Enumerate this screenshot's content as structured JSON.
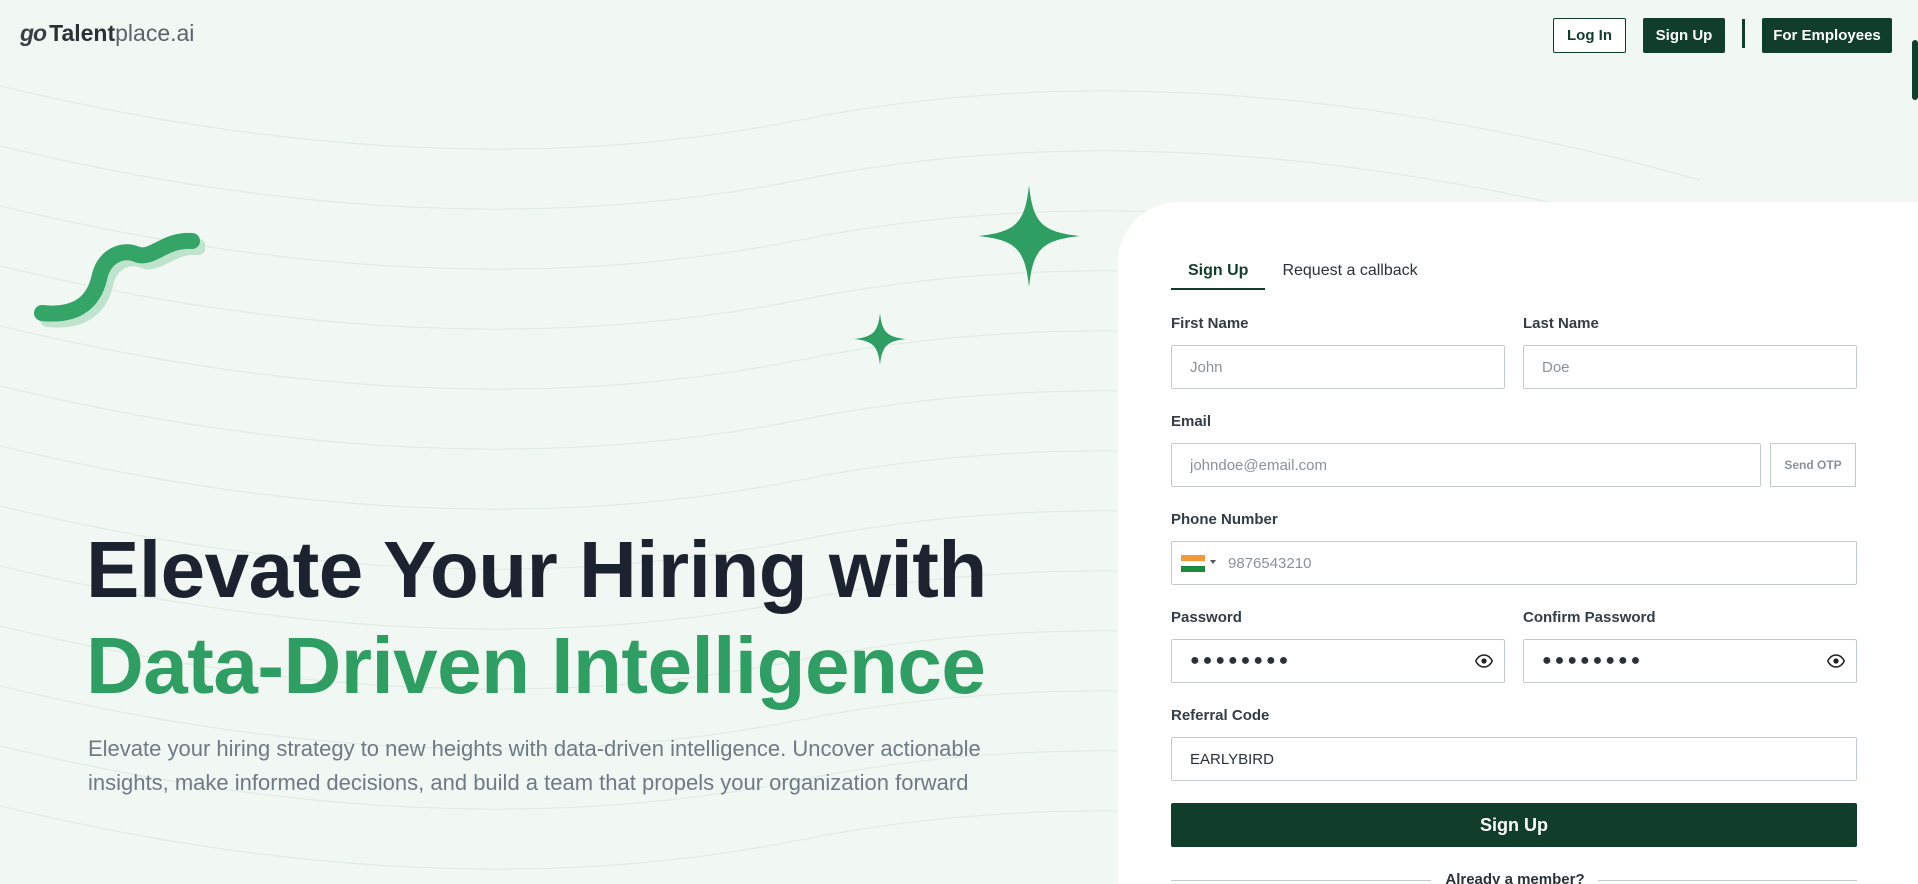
{
  "header": {
    "logo": {
      "go": "go",
      "talent": "Talent",
      "place": "place.ai"
    },
    "login_label": "Log In",
    "signup_label": "Sign Up",
    "employees_label": "For Employees"
  },
  "hero": {
    "title_line1": "Elevate Your Hiring with",
    "title_line2": "Data-Driven Intelligence",
    "subtitle": "Elevate your hiring strategy to new heights with data-driven intelligence. Uncover actionable insights, make informed decisions, and build a team that propels your organization forward"
  },
  "form": {
    "tabs": [
      {
        "label": "Sign Up",
        "active": true
      },
      {
        "label": "Request a callback",
        "active": false
      }
    ],
    "first_name": {
      "label": "First Name",
      "placeholder": "John"
    },
    "last_name": {
      "label": "Last Name",
      "placeholder": "Doe"
    },
    "email": {
      "label": "Email",
      "placeholder": "johndoe@email.com"
    },
    "send_otp_label": "Send OTP",
    "phone": {
      "label": "Phone Number",
      "placeholder": "9876543210",
      "country_flag": "india-flag-icon"
    },
    "password": {
      "label": "Password",
      "value": "●●●●●●●●"
    },
    "confirm_password": {
      "label": "Confirm Password",
      "value": "●●●●●●●●"
    },
    "referral": {
      "label": "Referral Code",
      "value": "EARLYBIRD"
    },
    "submit_label": "Sign Up",
    "already_member": "Already a member?"
  },
  "colors": {
    "brand_dark": "#103e2b",
    "brand_green": "#2f9e62",
    "background": "#f1f7f3"
  }
}
